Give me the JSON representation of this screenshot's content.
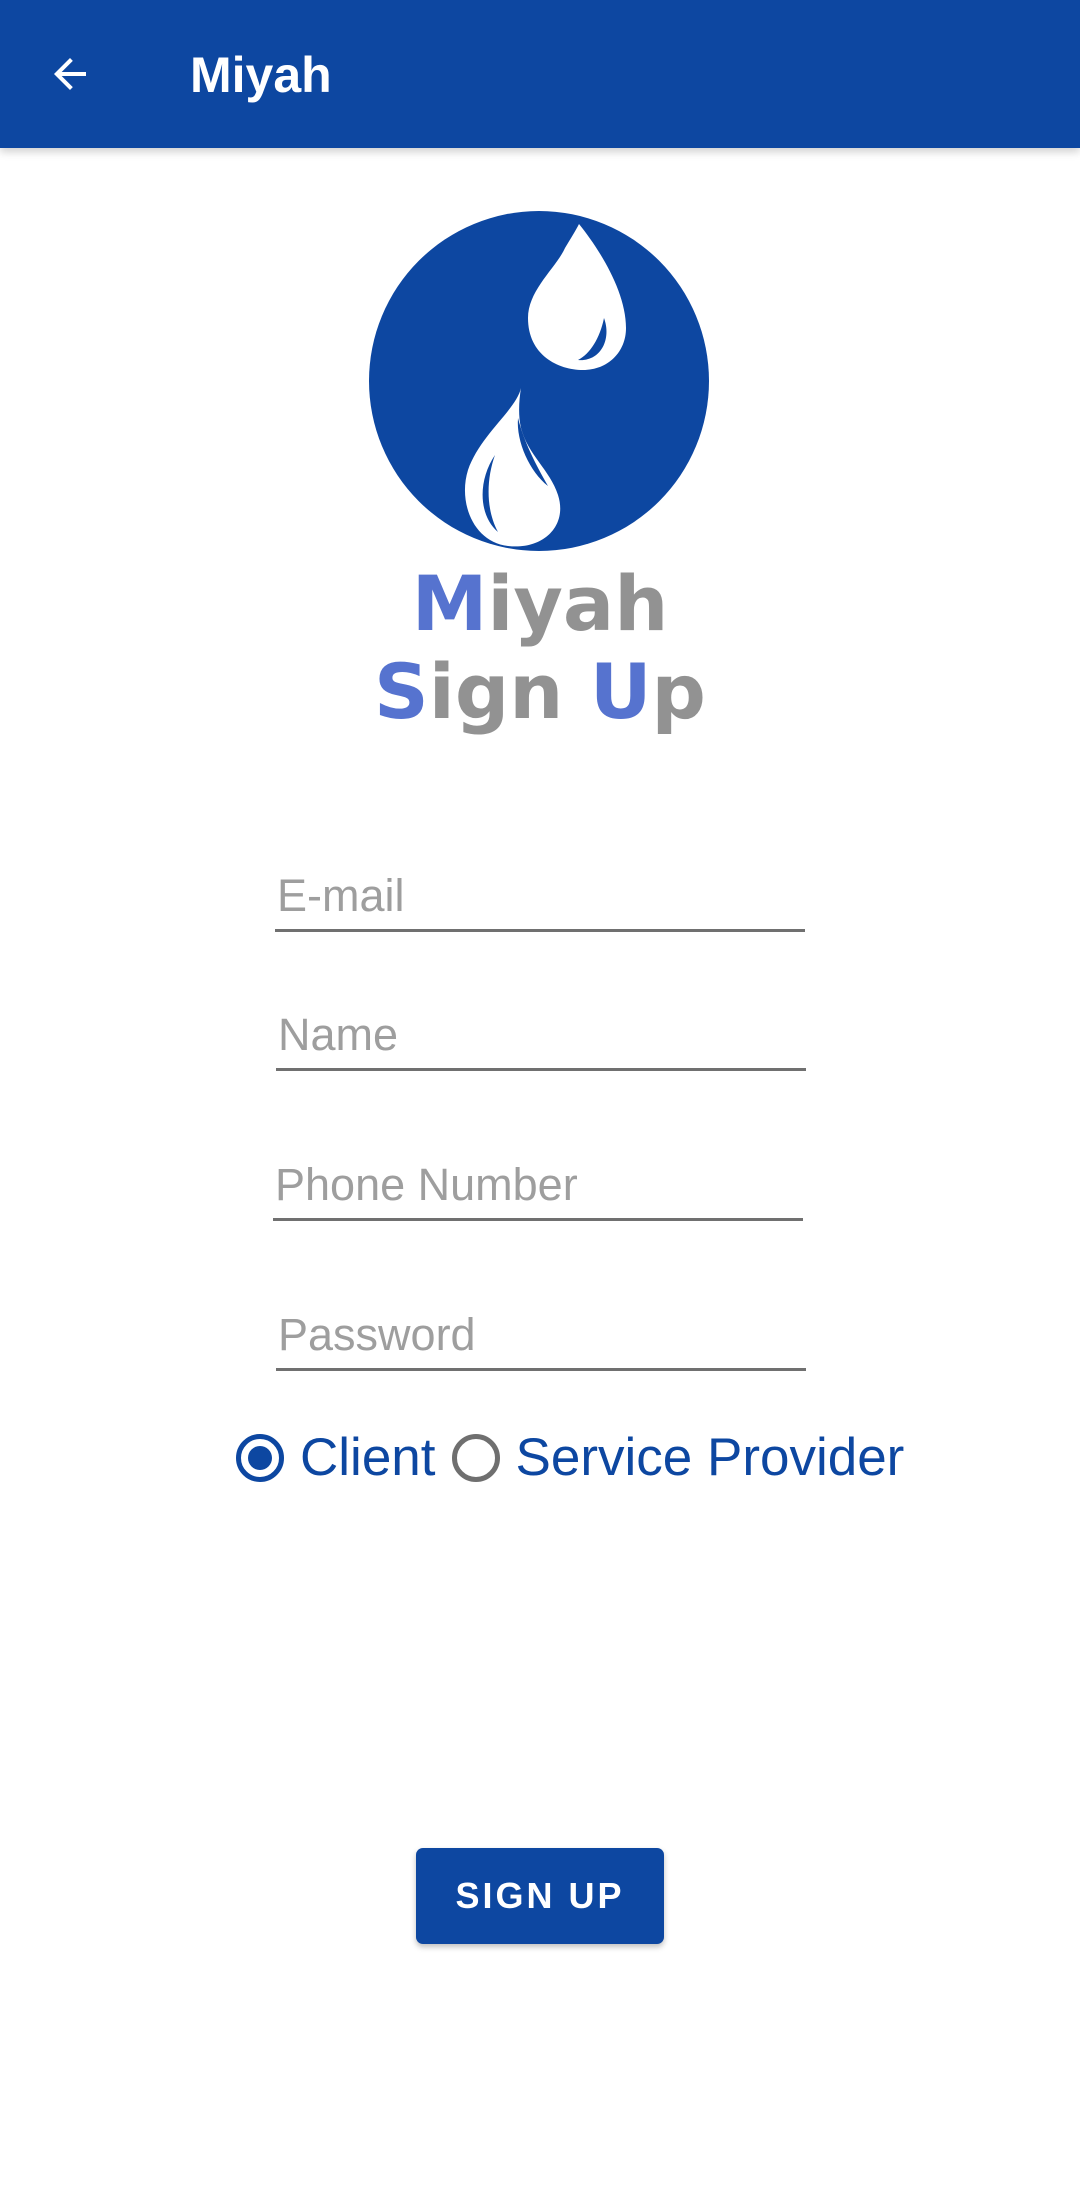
{
  "appbar": {
    "title": "Miyah",
    "back_icon": "arrow-left-icon"
  },
  "logo": {
    "icon": "water-drops-logo",
    "color": "#0d47a1"
  },
  "heading": {
    "line1_accent": "M",
    "line1_rest": "iyah",
    "line2_s_accent": "S",
    "line2_mid": "ign ",
    "line2_u_accent": "U",
    "line2_end": "p"
  },
  "form": {
    "email": {
      "placeholder": "E-mail",
      "value": ""
    },
    "name": {
      "placeholder": "Name",
      "value": ""
    },
    "phone": {
      "placeholder": "Phone Number",
      "value": ""
    },
    "password": {
      "placeholder": "Password",
      "value": ""
    }
  },
  "role": {
    "options": [
      "Client",
      "Service Provider"
    ],
    "selected": "Client"
  },
  "signup_button": {
    "label": "SIGN UP"
  },
  "colors": {
    "primary": "#0d47a1",
    "heading_accent": "#5673cf",
    "heading_grey": "#929292"
  }
}
